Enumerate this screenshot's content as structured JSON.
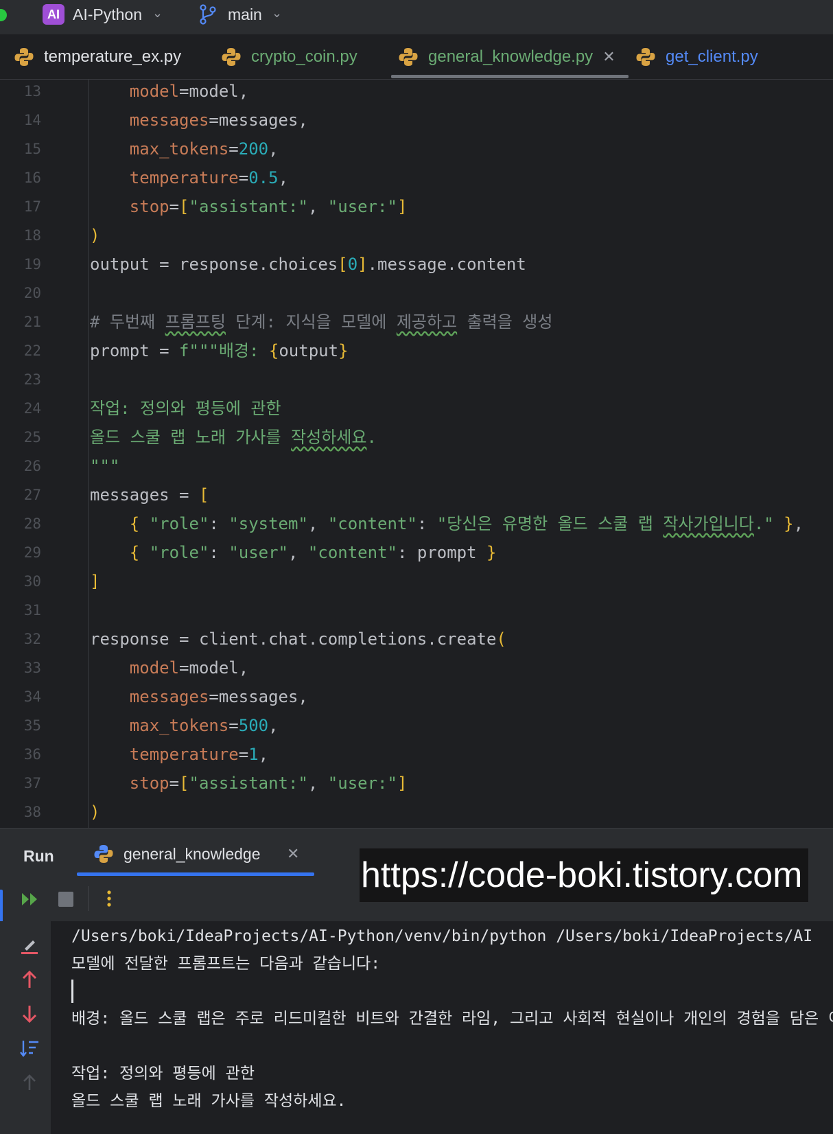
{
  "titlebar": {
    "project_badge": "AI",
    "project_name": "AI-Python",
    "branch_name": "main"
  },
  "tabs": [
    {
      "label": "temperature_ex.py",
      "color": "#dfe1e5"
    },
    {
      "label": "crypto_coin.py",
      "color": "#6aab73"
    },
    {
      "label": "general_knowledge.py",
      "color": "#6aab73",
      "active": true
    },
    {
      "label": "get_client.py",
      "color": "#548af7"
    }
  ],
  "editor": {
    "line_numbers": [
      "13",
      "14",
      "15",
      "16",
      "17",
      "18",
      "19",
      "20",
      "21",
      "22",
      "23",
      "24",
      "25",
      "26",
      "27",
      "28",
      "29",
      "30",
      "31",
      "32",
      "33",
      "34",
      "35",
      "36",
      "37",
      "38"
    ],
    "lines": [
      [
        [
          "p",
          "    model"
        ],
        [
          "t",
          "=model,"
        ]
      ],
      [
        [
          "p",
          "    messages"
        ],
        [
          "t",
          "=messages,"
        ]
      ],
      [
        [
          "p",
          "    max_tokens"
        ],
        [
          "t",
          "="
        ],
        [
          "n",
          "200"
        ],
        [
          "t",
          ","
        ]
      ],
      [
        [
          "p",
          "    temperature"
        ],
        [
          "t",
          "="
        ],
        [
          "n",
          "0.5"
        ],
        [
          "t",
          ","
        ]
      ],
      [
        [
          "p",
          "    stop"
        ],
        [
          "t",
          "="
        ],
        [
          "b",
          "["
        ],
        [
          "s",
          "\"assistant:\""
        ],
        [
          "t",
          ", "
        ],
        [
          "s",
          "\"user:\""
        ],
        [
          "b",
          "]"
        ]
      ],
      [
        [
          "b",
          ")"
        ]
      ],
      [
        [
          "t",
          "output = response.choices"
        ],
        [
          "b",
          "["
        ],
        [
          "n",
          "0"
        ],
        [
          "b",
          "]"
        ],
        [
          "t",
          ".message.content"
        ]
      ],
      [],
      [
        [
          "c",
          "# 두번째 "
        ],
        [
          "cs",
          "프롬프팅"
        ],
        [
          "c",
          " 단계: 지식을 모델에 "
        ],
        [
          "cs",
          "제공하고"
        ],
        [
          "c",
          " 출력을 생성"
        ]
      ],
      [
        [
          "t",
          "prompt = "
        ],
        [
          "s",
          "f\"\"\"배경: "
        ],
        [
          "b",
          "{"
        ],
        [
          "t",
          "output"
        ],
        [
          "b",
          "}"
        ]
      ],
      [],
      [
        [
          "s",
          "작업: 정의와 평등에 관한"
        ]
      ],
      [
        [
          "s",
          "올드 스쿨 랩 노래 가사를 "
        ],
        [
          "ss",
          "작성하세요"
        ],
        [
          "s",
          "."
        ]
      ],
      [
        [
          "s",
          "\"\"\""
        ]
      ],
      [
        [
          "t",
          "messages = "
        ],
        [
          "b",
          "["
        ]
      ],
      [
        [
          "t",
          "    "
        ],
        [
          "b",
          "{"
        ],
        [
          "s",
          " \"role\""
        ],
        [
          "t",
          ": "
        ],
        [
          "s",
          "\"system\""
        ],
        [
          "t",
          ", "
        ],
        [
          "s",
          "\"content\""
        ],
        [
          "t",
          ": "
        ],
        [
          "s",
          "\"당신은 유명한 올드 스쿨 랩 "
        ],
        [
          "ss",
          "작사가입니다"
        ],
        [
          "s",
          ".\""
        ],
        [
          "b",
          " }"
        ],
        [
          "t",
          ","
        ]
      ],
      [
        [
          "t",
          "    "
        ],
        [
          "b",
          "{"
        ],
        [
          "s",
          " \"role\""
        ],
        [
          "t",
          ": "
        ],
        [
          "s",
          "\"user\""
        ],
        [
          "t",
          ", "
        ],
        [
          "s",
          "\"content\""
        ],
        [
          "t",
          ": prompt "
        ],
        [
          "b",
          "}"
        ]
      ],
      [
        [
          "b",
          "]"
        ]
      ],
      [],
      [
        [
          "t",
          "response = client.chat.completions.create"
        ],
        [
          "b",
          "("
        ]
      ],
      [
        [
          "p",
          "    model"
        ],
        [
          "t",
          "=model,"
        ]
      ],
      [
        [
          "p",
          "    messages"
        ],
        [
          "t",
          "=messages,"
        ]
      ],
      [
        [
          "p",
          "    max_tokens"
        ],
        [
          "t",
          "="
        ],
        [
          "n",
          "500"
        ],
        [
          "t",
          ","
        ]
      ],
      [
        [
          "p",
          "    temperature"
        ],
        [
          "t",
          "="
        ],
        [
          "n",
          "1"
        ],
        [
          "t",
          ","
        ]
      ],
      [
        [
          "p",
          "    stop"
        ],
        [
          "t",
          "="
        ],
        [
          "b",
          "["
        ],
        [
          "s",
          "\"assistant:\""
        ],
        [
          "t",
          ", "
        ],
        [
          "s",
          "\"user:\""
        ],
        [
          "b",
          "]"
        ]
      ],
      [
        [
          "b",
          ")"
        ]
      ]
    ]
  },
  "run": {
    "title": "Run",
    "tab_label": "general_knowledge",
    "watermark": "https://code-boki.tistory.com",
    "console_lines": [
      "/Users/boki/IdeaProjects/AI-Python/venv/bin/python /Users/boki/IdeaProjects/AI",
      "모델에 전달한 프롬프트는 다음과 같습니다:",
      "",
      "배경: 올드 스쿨 랩은 주로 리드미컬한 비트와 간결한 라임, 그리고 사회적 현실이나 개인의 경험을 담은 이",
      "",
      "작업: 정의와 평등에 관한",
      "올드 스쿨 랩 노래 가사를 작성하세요."
    ]
  },
  "colors": {
    "background": "#1e1f22",
    "panel": "#2b2d30",
    "keyword_param": "#c77b57",
    "number": "#2aacb8",
    "string": "#6aab73",
    "bracket": "#e8ba36",
    "accent": "#3574f0"
  },
  "icons": {
    "run_rerun": "double-play-icon",
    "run_stop": "stop-icon",
    "run_more": "more-vertical-icon",
    "console_clear": "clear-all-icon",
    "console_up": "arrow-up-icon",
    "console_down": "arrow-down-icon",
    "console_sort": "sort-icon",
    "console_scroll_top": "scroll-top-icon"
  }
}
